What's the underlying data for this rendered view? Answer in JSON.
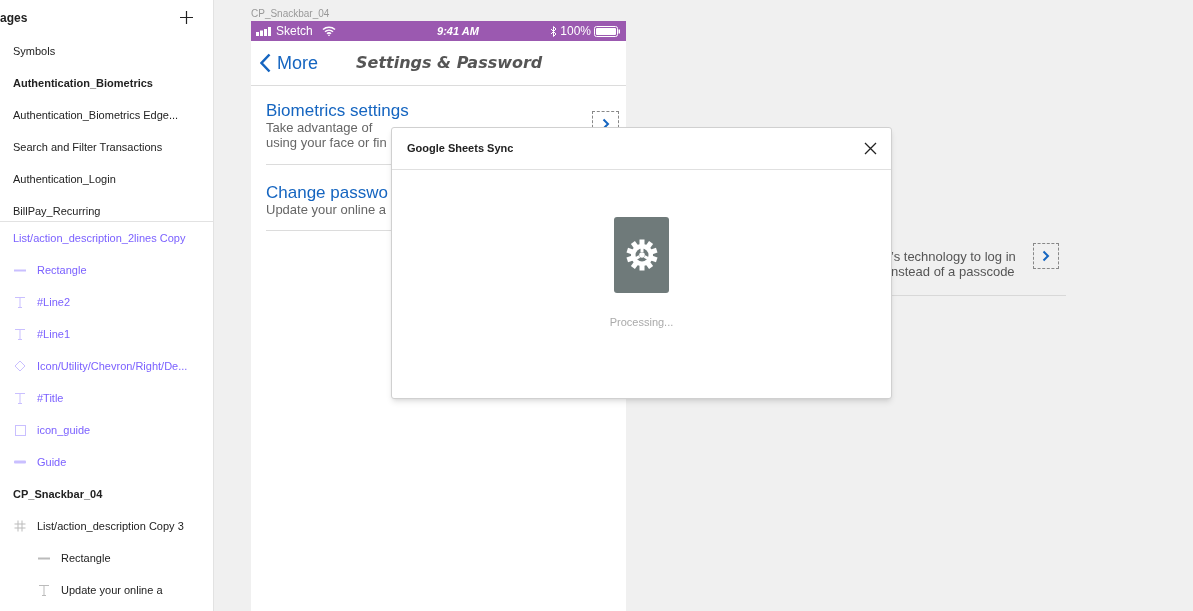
{
  "pages_panel": {
    "title": "ages",
    "pages": [
      {
        "label": "Symbols",
        "selected": false
      },
      {
        "label": "Authentication_Biometrics",
        "selected": true
      },
      {
        "label": "Authentication_Biometrics Edge...",
        "selected": false
      },
      {
        "label": "Search and Filter Transactions",
        "selected": false
      },
      {
        "label": "Authentication_Login",
        "selected": false
      },
      {
        "label": "BillPay_Recurring",
        "selected": false
      }
    ]
  },
  "layers": [
    {
      "label": "List/action_description_2lines Copy",
      "kind": "symbol",
      "symbol_part": true,
      "children": [
        {
          "label": "Rectangle",
          "kind": "line",
          "symbol_part": true
        },
        {
          "label": "#Line2",
          "kind": "text",
          "symbol_part": true
        },
        {
          "label": "#Line1",
          "kind": "text",
          "symbol_part": true
        },
        {
          "label": "Icon/Utility/Chevron/Right/De...",
          "kind": "symbol",
          "symbol_part": true
        },
        {
          "label": "#Title",
          "kind": "text",
          "symbol_part": true
        },
        {
          "label": "icon_guide",
          "kind": "shape",
          "symbol_part": true
        },
        {
          "label": "Guide",
          "kind": "guide",
          "symbol_part": true
        }
      ]
    },
    {
      "label": "CP_Snackbar_04",
      "kind": "artboard",
      "symbol_part": false,
      "children": [
        {
          "label": "List/action_description Copy 3",
          "kind": "frame",
          "symbol_part": false,
          "children": [
            {
              "label": "Rectangle",
              "kind": "line",
              "symbol_part": false
            },
            {
              "label": "Update your online a",
              "kind": "text",
              "symbol_part": false
            }
          ]
        }
      ]
    }
  ],
  "artboard": {
    "label": "CP_Snackbar_04",
    "status_bar": {
      "carrier": "Sketch",
      "time": "9:41 AM",
      "battery": "100%"
    },
    "nav": {
      "back": "More",
      "title": "Settings & Password"
    },
    "rows": [
      {
        "title": "Biometrics settings",
        "lines": [
          "Take advantage of",
          "using your face or fin"
        ],
        "chevron": true
      },
      {
        "title": "Change passwo",
        "lines": [
          "Update your online a"
        ],
        "chevron": false
      }
    ]
  },
  "canvas_fragment": {
    "lines": [
      "’s technology to log in",
      "nstead of a passcode"
    ]
  },
  "dialog": {
    "title": "Google Sheets Sync",
    "status": "Processing..."
  }
}
